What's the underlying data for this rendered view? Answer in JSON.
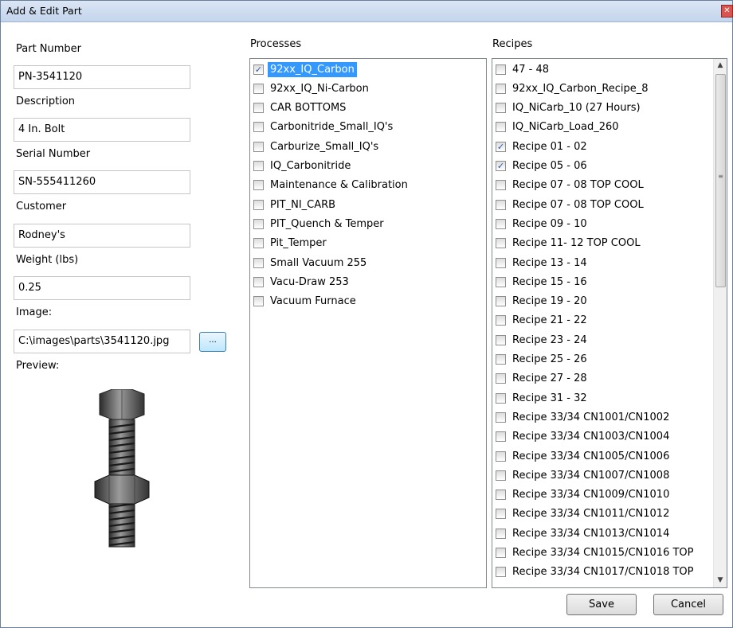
{
  "window": {
    "title": "Add & Edit Part",
    "close_glyph": "✕"
  },
  "form": {
    "part_number_label": "Part Number",
    "part_number_value": "PN-3541120",
    "description_label": "Description",
    "description_value": "4 In. Bolt",
    "serial_number_label": "Serial Number",
    "serial_number_value": "SN-555411260",
    "customer_label": "Customer",
    "customer_value": "Rodney's",
    "weight_label": "Weight (lbs)",
    "weight_value": "0.25",
    "image_label": "Image:",
    "image_value": "C:\\images\\parts\\3541120.jpg",
    "browse_label": "...",
    "preview_label": "Preview:",
    "preview_icon": "bolt-with-nut-image"
  },
  "processes": {
    "label": "Processes",
    "items": [
      {
        "label": "92xx_IQ_Carbon",
        "checked": true,
        "selected": true
      },
      {
        "label": "92xx_IQ_Ni-Carbon",
        "checked": false
      },
      {
        "label": "CAR BOTTOMS",
        "checked": false
      },
      {
        "label": "Carbonitride_Small_IQ's",
        "checked": false
      },
      {
        "label": "Carburize_Small_IQ's",
        "checked": false
      },
      {
        "label": "IQ_Carbonitride",
        "checked": false
      },
      {
        "label": "Maintenance & Calibration",
        "checked": false
      },
      {
        "label": "PIT_NI_CARB",
        "checked": false
      },
      {
        "label": "PIT_Quench & Temper",
        "checked": false
      },
      {
        "label": "Pit_Temper",
        "checked": false
      },
      {
        "label": "Small Vacuum 255",
        "checked": false
      },
      {
        "label": "Vacu-Draw 253",
        "checked": false
      },
      {
        "label": "Vacuum Furnace",
        "checked": false
      }
    ]
  },
  "recipes": {
    "label": "Recipes",
    "items": [
      {
        "label": "47 - 48",
        "checked": false
      },
      {
        "label": "92xx_IQ_Carbon_Recipe_8",
        "checked": false
      },
      {
        "label": "IQ_NiCarb_10 (27 Hours)",
        "checked": false
      },
      {
        "label": "IQ_NiCarb_Load_260",
        "checked": false
      },
      {
        "label": "Recipe 01 - 02",
        "checked": true
      },
      {
        "label": "Recipe 05 - 06",
        "checked": true
      },
      {
        "label": "Recipe 07 - 08 TOP COOL",
        "checked": false
      },
      {
        "label": "Recipe 07 - 08 TOP COOL",
        "checked": false
      },
      {
        "label": "Recipe 09 - 10",
        "checked": false
      },
      {
        "label": "Recipe 11- 12 TOP COOL",
        "checked": false
      },
      {
        "label": "Recipe 13 - 14",
        "checked": false
      },
      {
        "label": "Recipe 15 - 16",
        "checked": false
      },
      {
        "label": "Recipe 19 - 20",
        "checked": false
      },
      {
        "label": "Recipe 21 - 22",
        "checked": false
      },
      {
        "label": "Recipe 23 - 24",
        "checked": false
      },
      {
        "label": "Recipe 25 - 26",
        "checked": false
      },
      {
        "label": "Recipe 27 - 28",
        "checked": false
      },
      {
        "label": "Recipe 31 - 32",
        "checked": false
      },
      {
        "label": "Recipe 33/34 CN1001/CN1002",
        "checked": false
      },
      {
        "label": "Recipe 33/34 CN1003/CN1004",
        "checked": false
      },
      {
        "label": "Recipe 33/34 CN1005/CN1006",
        "checked": false
      },
      {
        "label": "Recipe 33/34 CN1007/CN1008",
        "checked": false
      },
      {
        "label": "Recipe 33/34 CN1009/CN1010",
        "checked": false
      },
      {
        "label": "Recipe 33/34 CN1011/CN1012",
        "checked": false
      },
      {
        "label": "Recipe 33/34 CN1013/CN1014",
        "checked": false
      },
      {
        "label": "Recipe 33/34 CN1015/CN1016 TOP",
        "checked": false
      },
      {
        "label": "Recipe 33/34 CN1017/CN1018 TOP",
        "checked": false
      }
    ],
    "scroll_up_glyph": "▲",
    "scroll_down_glyph": "▼",
    "grip_glyph": "≡"
  },
  "buttons": {
    "save_label": "Save",
    "cancel_label": "Cancel"
  },
  "colors": {
    "selection": "#3399ff",
    "checkmark": "#2457a8",
    "titlebar": "#c3d4ec"
  }
}
